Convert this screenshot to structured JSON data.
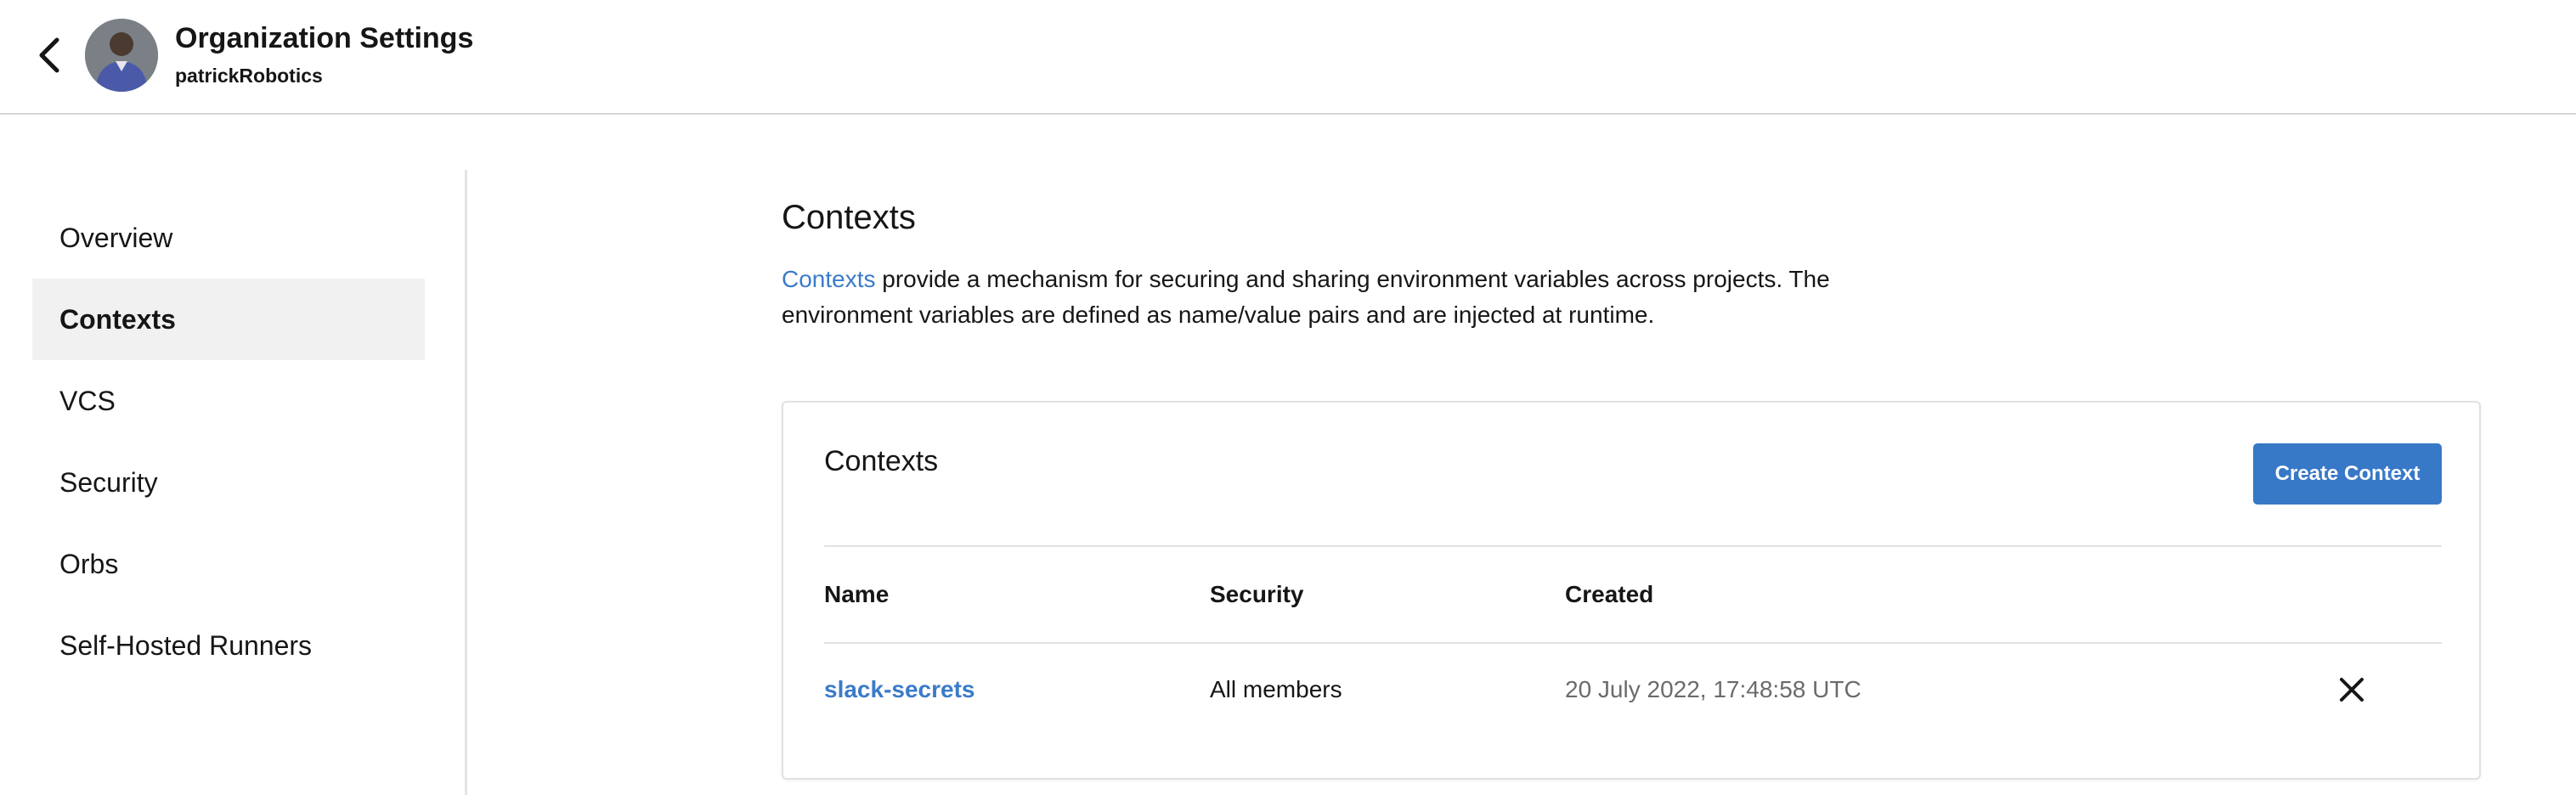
{
  "header": {
    "title": "Organization Settings",
    "org_name": "patrickRobotics"
  },
  "sidebar": {
    "items": [
      {
        "label": "Overview",
        "active": false
      },
      {
        "label": "Contexts",
        "active": true
      },
      {
        "label": "VCS",
        "active": false
      },
      {
        "label": "Security",
        "active": false
      },
      {
        "label": "Orbs",
        "active": false
      },
      {
        "label": "Self-Hosted Runners",
        "active": false
      }
    ]
  },
  "main": {
    "title": "Contexts",
    "description_link": "Contexts",
    "description_text": " provide a mechanism for securing and sharing environment variables across projects. The environment variables are defined as name/value pairs and are injected at runtime.",
    "card": {
      "title": "Contexts",
      "create_button_label": "Create Context",
      "columns": [
        "Name",
        "Security",
        "Created"
      ],
      "rows": [
        {
          "name": "slack-secrets",
          "security": "All members",
          "created": "20 July 2022, 17:48:58 UTC"
        }
      ]
    }
  },
  "colors": {
    "link": "#3b7bc9",
    "primary_button": "#3778c7",
    "active_nav_bg": "#f1f1f1"
  },
  "icons": {
    "back": "chevron-left-icon",
    "delete": "close-icon"
  }
}
